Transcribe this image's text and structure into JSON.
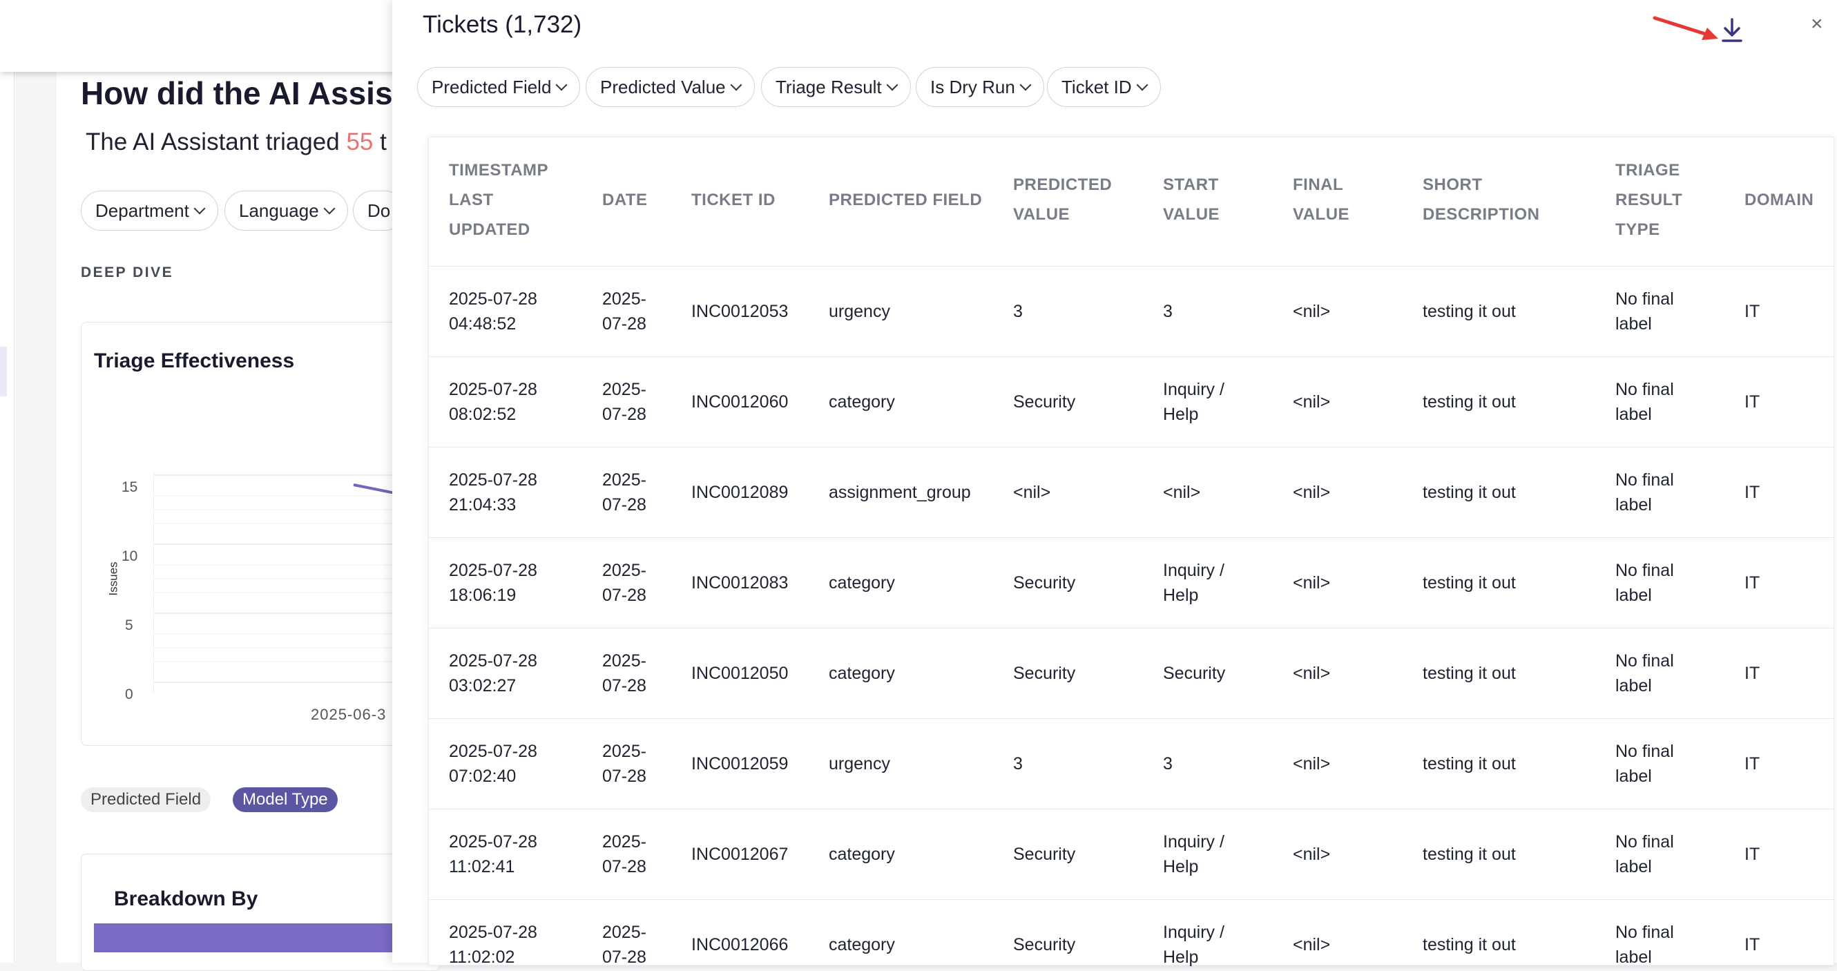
{
  "background": {
    "heading": "How did the AI Assista",
    "subtitle_prefix": "The AI Assistant triaged",
    "subtitle_number": "55",
    "subtitle_suffix": "t",
    "filters": [
      "Department",
      "Language",
      "Do"
    ],
    "section_label": "DEEP DIVE",
    "chart": {
      "title": "Triage Effectiveness",
      "y_axis_label": "Issues",
      "y_ticks": [
        "15",
        "10",
        "5",
        "0"
      ],
      "x_tick": "2025-06-3"
    },
    "tags": [
      "Predicted Field",
      "Model Type"
    ],
    "breakdown_title": "Breakdown By"
  },
  "panel": {
    "title": "Tickets (1,732)",
    "filters": [
      "Predicted Field",
      "Predicted Value",
      "Triage Result",
      "Is Dry Run",
      "Ticket ID"
    ],
    "download_icon": "download-icon",
    "close_label": "×",
    "columns": [
      "TIMESTAMP LAST UPDATED",
      "DATE",
      "TICKET ID",
      "PREDICTED FIELD",
      "PREDICTED VALUE",
      "START VALUE",
      "FINAL VALUE",
      "SHORT DESCRIPTION",
      "TRIAGE RESULT TYPE",
      "DOMAIN"
    ],
    "rows": [
      {
        "timestamp": "2025-07-28 04:48:52",
        "date": "2025-07-28",
        "ticket_id": "INC0012053",
        "predicted_field": "urgency",
        "predicted_value": "3",
        "start_value": "3",
        "final_value": "<nil>",
        "short_description": "testing it out",
        "triage_result": "No final label",
        "domain": "IT"
      },
      {
        "timestamp": "2025-07-28 08:02:52",
        "date": "2025-07-28",
        "ticket_id": "INC0012060",
        "predicted_field": "category",
        "predicted_value": "Security",
        "start_value": "Inquiry / Help",
        "final_value": "<nil>",
        "short_description": "testing it out",
        "triage_result": "No final label",
        "domain": "IT"
      },
      {
        "timestamp": "2025-07-28 21:04:33",
        "date": "2025-07-28",
        "ticket_id": "INC0012089",
        "predicted_field": "assignment_group",
        "predicted_value": "<nil>",
        "start_value": "<nil>",
        "final_value": "<nil>",
        "short_description": "testing it out",
        "triage_result": "No final label",
        "domain": "IT"
      },
      {
        "timestamp": "2025-07-28 18:06:19",
        "date": "2025-07-28",
        "ticket_id": "INC0012083",
        "predicted_field": "category",
        "predicted_value": "Security",
        "start_value": "Inquiry / Help",
        "final_value": "<nil>",
        "short_description": "testing it out",
        "triage_result": "No final label",
        "domain": "IT"
      },
      {
        "timestamp": "2025-07-28 03:02:27",
        "date": "2025-07-28",
        "ticket_id": "INC0012050",
        "predicted_field": "category",
        "predicted_value": "Security",
        "start_value": "Security",
        "final_value": "<nil>",
        "short_description": "testing it out",
        "triage_result": "No final label",
        "domain": "IT"
      },
      {
        "timestamp": "2025-07-28 07:02:40",
        "date": "2025-07-28",
        "ticket_id": "INC0012059",
        "predicted_field": "urgency",
        "predicted_value": "3",
        "start_value": "3",
        "final_value": "<nil>",
        "short_description": "testing it out",
        "triage_result": "No final label",
        "domain": "IT"
      },
      {
        "timestamp": "2025-07-28 11:02:41",
        "date": "2025-07-28",
        "ticket_id": "INC0012067",
        "predicted_field": "category",
        "predicted_value": "Security",
        "start_value": "Inquiry / Help",
        "final_value": "<nil>",
        "short_description": "testing it out",
        "triage_result": "No final label",
        "domain": "IT"
      },
      {
        "timestamp": "2025-07-28 11:02:02",
        "date": "2025-07-28",
        "ticket_id": "INC0012066",
        "predicted_field": "category",
        "predicted_value": "Security",
        "start_value": "Inquiry / Help",
        "final_value": "<nil>",
        "short_description": "testing it out",
        "triage_result": "No final label",
        "domain": "IT"
      }
    ]
  },
  "colors": {
    "accent_purple": "#5c55a3",
    "highlight_number": "#e57373",
    "annotation_arrow": "#e53935"
  }
}
